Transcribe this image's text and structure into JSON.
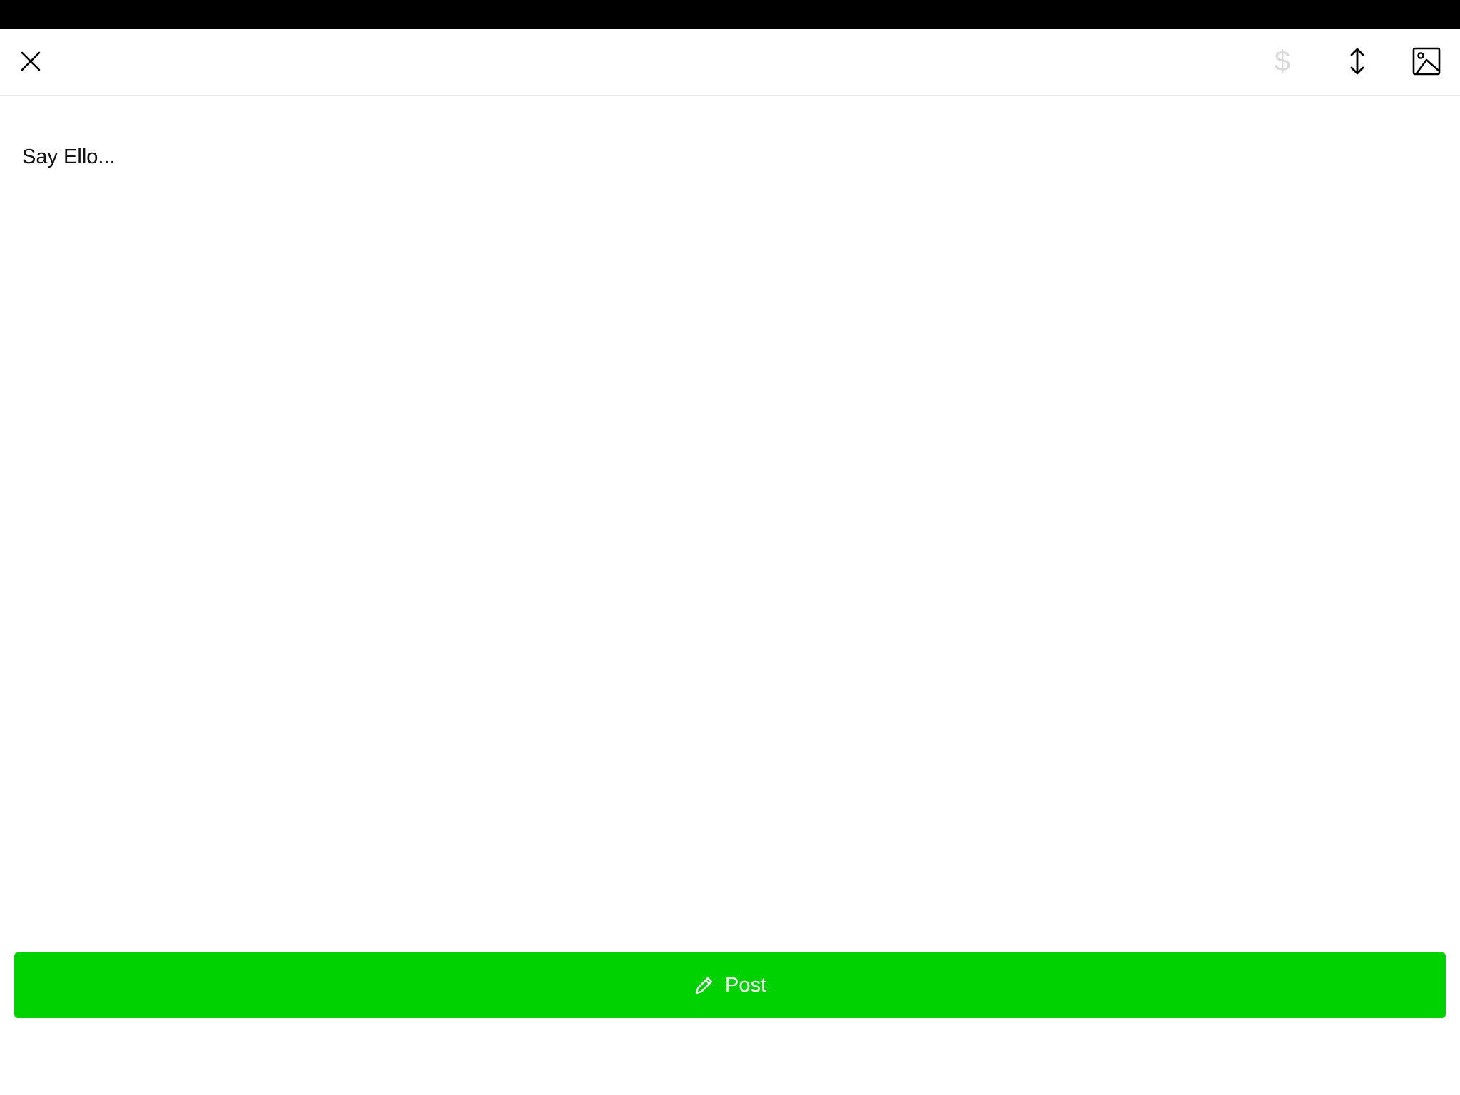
{
  "toolbar": {
    "close_icon": "close-icon",
    "money_icon": "dollar-icon",
    "money_glyph": "$",
    "resize_icon": "vertical-resize-icon",
    "image_icon": "image-icon"
  },
  "editor": {
    "placeholder": "Say Ello..."
  },
  "post_button": {
    "label": "Post",
    "icon": "pencil-icon"
  },
  "colors": {
    "accent": "#00d100",
    "status_bar": "#000000",
    "disabled_icon": "#d9d9d9"
  }
}
